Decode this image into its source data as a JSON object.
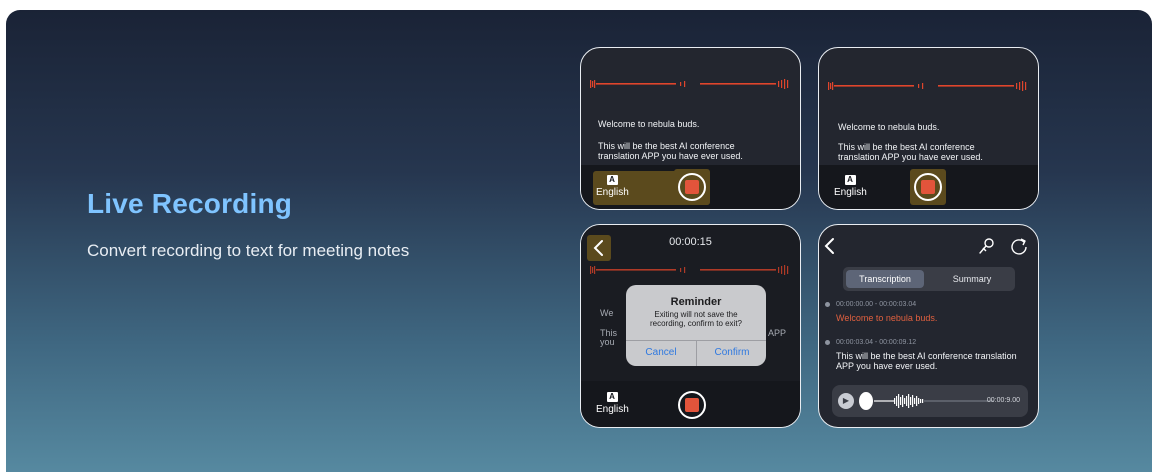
{
  "hero": {
    "title": "Live Recording",
    "subtitle": "Convert recording to text for meeting notes"
  },
  "colors": {
    "accent_title": "#7fc4ff",
    "waveform": "#e0452c",
    "record_button": "#e2543b",
    "highlight": "#5b4a1d",
    "dialog_button": "#2f79e0"
  },
  "screen_recording": {
    "line1": "Welcome to nebula buds.",
    "line2": "This will be the best AI conference translation APP you have ever used.",
    "language": "English",
    "language_icon": "translate-icon"
  },
  "screen_exit": {
    "timer": "00:00:15",
    "partial_left_1": "We",
    "partial_left_2": "This",
    "partial_left_3": "you",
    "partial_right": "APP",
    "dialog": {
      "title": "Reminder",
      "message": "Exiting will not save the recording, confirm to exit?",
      "cancel": "Cancel",
      "confirm": "Confirm"
    },
    "language": "English"
  },
  "screen_transcript": {
    "tabs": [
      "Transcription",
      "Summary"
    ],
    "active_tab": "Transcription",
    "entries": [
      {
        "time": "00:00:00.00 - 00:00:03.04",
        "text": "Welcome to nebula buds.",
        "highlighted": true
      },
      {
        "time": "00:00:03.04 - 00:00:09.12",
        "text": "This will be the best AI conference translation APP you have ever used.",
        "highlighted": false
      }
    ],
    "duration": "00:00:9.00",
    "icons": [
      "back-icon",
      "speaker-icon",
      "share-icon",
      "play-icon"
    ]
  }
}
